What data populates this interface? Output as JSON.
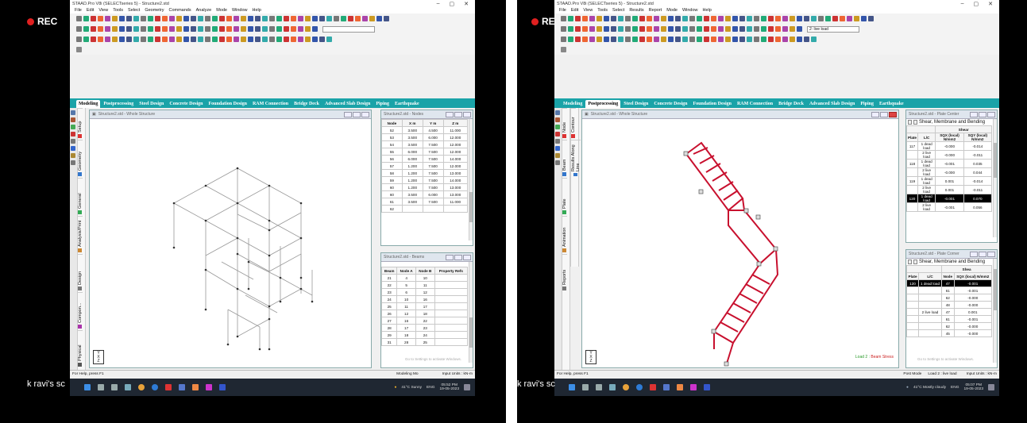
{
  "left": {
    "rec": "REC",
    "window_title": "STAAD.Pro V8i (SELECTseries 5) - Structure2.std",
    "menu": [
      "File",
      "Edit",
      "View",
      "Tools",
      "Select",
      "Geometry",
      "Commands",
      "Analyze",
      "Mode",
      "Window",
      "Help"
    ],
    "tabs": [
      "Modeling",
      "Postprocessing",
      "Steel Design",
      "Concrete Design",
      "Foundation Design",
      "RAM Connection",
      "Bridge Deck",
      "Advanced Slab Design",
      "Piping",
      "Earthquake"
    ],
    "active_tab": "Modeling",
    "sidebar": [
      "Setup",
      "Geometry",
      "General",
      "Analysis/Print",
      "Design",
      "Compon...",
      "Physical"
    ],
    "view_title": "Structure2.std - Whole Structure",
    "axis": {
      "y": "Y",
      "x": "X",
      "z": "Z"
    },
    "nodes_title": "Structure2.std - Nodes",
    "nodes_headers": [
      "Node",
      "X m",
      "Y m",
      "Z m"
    ],
    "nodes_rows": [
      [
        "52",
        "3.500",
        "4.500",
        "11.000"
      ],
      [
        "53",
        "3.500",
        "6.000",
        "12.000"
      ],
      [
        "54",
        "3.500",
        "7.500",
        "12.000"
      ],
      [
        "55",
        "6.000",
        "7.500",
        "12.000"
      ],
      [
        "56",
        "6.000",
        "7.500",
        "14.000"
      ],
      [
        "57",
        "1.200",
        "7.500",
        "12.000"
      ],
      [
        "58",
        "1.200",
        "7.500",
        "13.000"
      ],
      [
        "59",
        "1.200",
        "7.500",
        "14.000"
      ],
      [
        "60",
        "1.200",
        "7.500",
        "13.000"
      ],
      [
        "60",
        "3.500",
        "6.000",
        "13.000"
      ],
      [
        "61",
        "3.500",
        "7.500",
        "11.000"
      ],
      [
        "62",
        "",
        "",
        ""
      ]
    ],
    "beams_title": "Structure2.std - Beams",
    "beams_headers": [
      "Beam",
      "Node A",
      "Node B",
      "Property Refs"
    ],
    "beams_rows": [
      [
        "21",
        "4",
        "10",
        ""
      ],
      [
        "22",
        "5",
        "11",
        ""
      ],
      [
        "23",
        "6",
        "12",
        ""
      ],
      [
        "24",
        "10",
        "16",
        ""
      ],
      [
        "25",
        "11",
        "17",
        ""
      ],
      [
        "26",
        "12",
        "18",
        ""
      ],
      [
        "27",
        "16",
        "22",
        ""
      ],
      [
        "28",
        "17",
        "23",
        ""
      ],
      [
        "29",
        "18",
        "24",
        ""
      ],
      [
        "31",
        "28",
        "25",
        ""
      ]
    ],
    "activate": "Go to Settings to activate Windows.",
    "status_left": "For Help, press F1",
    "status_mid": "Modeling Mo",
    "status_right": "Input Units : kN-m",
    "weather": "41°C Sunny",
    "lang": "ENG",
    "time": "05:52 PM",
    "date": "19-05-2023",
    "watermark": "k ravi's sc"
  },
  "right": {
    "rec": "REC",
    "window_title": "STAAD.Pro V8i (SELECTseries 5) - Structure2.std",
    "menu": [
      "File",
      "Edit",
      "View",
      "Tools",
      "Select",
      "Results",
      "Report",
      "Mode",
      "Window",
      "Help"
    ],
    "load_dropdown": "2: live load",
    "tabs": [
      "Modeling",
      "Postprocessing",
      "Steel Design",
      "Concrete Design",
      "Foundation Design",
      "RAM Connection",
      "Bridge Deck",
      "Advanced Slab Design",
      "Piping",
      "Earthquake"
    ],
    "active_tab": "Postprocessing",
    "sidebar": [
      "Node",
      "Beam",
      "Plate",
      "Animation",
      "Reports"
    ],
    "sidebar2": [
      "Contour",
      "Results Along Line"
    ],
    "view_title": "Structure2.std - Whole Structure",
    "axis": {
      "y": "Y",
      "x": "X",
      "z": "Z"
    },
    "load_label": "Load 2 :",
    "load_label2": "Beam Stress",
    "plate1_title": "Structure2.std - Plate Center",
    "plate_tab_label": "Shear, Membrane and Bending",
    "plate1_group": "Shear",
    "plate1_headers": [
      "Plate",
      "L/C",
      "SQX (local) N/mm2",
      "SQY (local) N/mm2"
    ],
    "plate1_rows": [
      [
        "117",
        "1 dead load",
        "-0.000",
        "-0.014"
      ],
      [
        "",
        "2 live load",
        "-0.000",
        "-0.011"
      ],
      [
        "118",
        "1 dead load",
        "-0.001",
        "0.035"
      ],
      [
        "",
        "2 live load",
        "-0.000",
        "0.044"
      ],
      [
        "119",
        "1 dead load",
        "0.001",
        "-0.014"
      ],
      [
        "",
        "2 live load",
        "0.001",
        "-0.011"
      ],
      [
        "120",
        "1 dead load",
        "-0.001",
        "0.070"
      ],
      [
        "",
        "2 live load",
        "-0.001",
        "0.056"
      ]
    ],
    "plate2_title": "Structure2.std - Plate Corner",
    "plate2_group": "Shea",
    "plate2_headers": [
      "Plate",
      "L/C",
      "Node",
      "SQX (local) N/mm2"
    ],
    "plate2_rows": [
      [
        "120",
        "1 dead load",
        "47",
        "-0.001"
      ],
      [
        "",
        "",
        "61",
        "-0.001"
      ],
      [
        "",
        "",
        "62",
        "-0.000"
      ],
      [
        "",
        "",
        "48",
        "-0.000"
      ],
      [
        "",
        "2 live load",
        "47",
        "0.001"
      ],
      [
        "",
        "",
        "61",
        "-0.001"
      ],
      [
        "",
        "",
        "62",
        "-0.000"
      ],
      [
        "",
        "",
        "45",
        "-0.000"
      ]
    ],
    "activate": "Go to Settings to activate Windows.",
    "status_left": "For Help, press F1",
    "status_mid": "Post Mode",
    "status_load": "Load 2 : live load",
    "status_right": "Input Units : kN-m",
    "weather": "41°C Mostly cloudy",
    "lang": "ENG",
    "time": "05:07 PM",
    "date": "19-05-2023",
    "watermark": "k ravi's sc"
  },
  "colors": {
    "tab_teal": "#1aa3a8",
    "member_red": "#c8102e",
    "taskbar": "#1f2732"
  }
}
